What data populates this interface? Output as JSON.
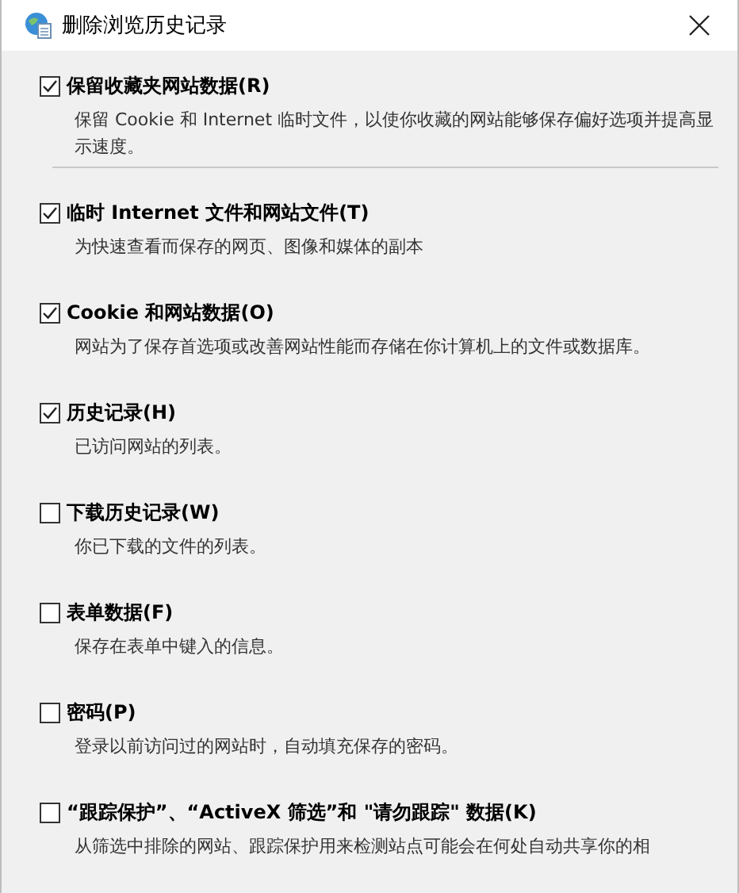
{
  "window": {
    "title": "删除浏览历史记录"
  },
  "items": [
    {
      "label": "保留收藏夹网站数据(R)",
      "checked": true,
      "description": "保留 Cookie 和 Internet 临时文件，以使你收藏的网站能够保存偏好选项并提高显示速度。",
      "separator_after": true
    },
    {
      "label": "临时 Internet 文件和网站文件(T)",
      "checked": true,
      "description": "为快速查看而保存的网页、图像和媒体的副本"
    },
    {
      "label": "Cookie 和网站数据(O)",
      "checked": true,
      "description": "网站为了保存首选项或改善网站性能而存储在你计算机上的文件或数据库。"
    },
    {
      "label": "历史记录(H)",
      "checked": true,
      "description": "已访问网站的列表。"
    },
    {
      "label": "下载历史记录(W)",
      "checked": false,
      "description": "你已下载的文件的列表。"
    },
    {
      "label": "表单数据(F)",
      "checked": false,
      "description": "保存在表单中键入的信息。"
    },
    {
      "label": "密码(P)",
      "checked": false,
      "description": "登录以前访问过的网站时，自动填充保存的密码。"
    },
    {
      "label": "“跟踪保护”、“ActiveX 筛选”和 \"请勿跟踪\" 数据(K)",
      "checked": false,
      "description": "从筛选中排除的网站、跟踪保护用来检测站点可能会在何处自动共享你的相"
    }
  ]
}
